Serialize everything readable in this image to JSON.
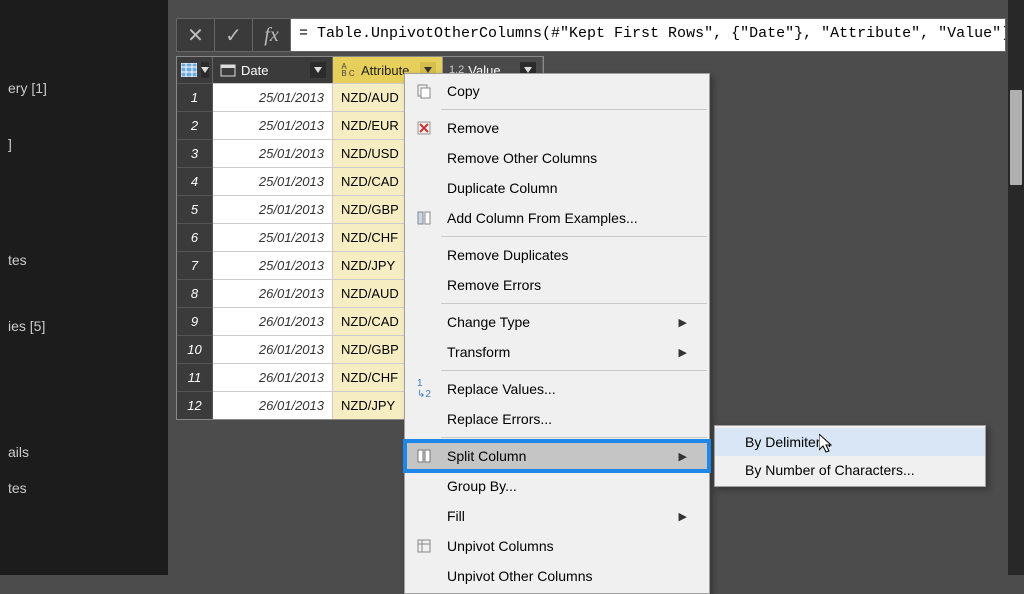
{
  "left_panel": {
    "items": [
      "ery [1]",
      "",
      "]",
      "",
      "tes",
      "",
      "ies [5]",
      "",
      "ails",
      "tes"
    ]
  },
  "formula": "= Table.UnpivotOtherColumns(#\"Kept First Rows\", {\"Date\"}, \"Attribute\", \"Value\")",
  "columns": {
    "date": "Date",
    "attribute": "Attribute",
    "value": "Value"
  },
  "rows": [
    {
      "n": "1",
      "date": "25/01/2013",
      "attr": "NZD/AUD"
    },
    {
      "n": "2",
      "date": "25/01/2013",
      "attr": "NZD/EUR"
    },
    {
      "n": "3",
      "date": "25/01/2013",
      "attr": "NZD/USD"
    },
    {
      "n": "4",
      "date": "25/01/2013",
      "attr": "NZD/CAD"
    },
    {
      "n": "5",
      "date": "25/01/2013",
      "attr": "NZD/GBP"
    },
    {
      "n": "6",
      "date": "25/01/2013",
      "attr": "NZD/CHF"
    },
    {
      "n": "7",
      "date": "25/01/2013",
      "attr": "NZD/JPY"
    },
    {
      "n": "8",
      "date": "26/01/2013",
      "attr": "NZD/AUD"
    },
    {
      "n": "9",
      "date": "26/01/2013",
      "attr": "NZD/CAD"
    },
    {
      "n": "10",
      "date": "26/01/2013",
      "attr": "NZD/GBP"
    },
    {
      "n": "11",
      "date": "26/01/2013",
      "attr": "NZD/CHF"
    },
    {
      "n": "12",
      "date": "26/01/2013",
      "attr": "NZD/JPY"
    }
  ],
  "ctx": {
    "copy": "Copy",
    "remove": "Remove",
    "remove_other": "Remove Other Columns",
    "duplicate": "Duplicate Column",
    "add_from_examples": "Add Column From Examples...",
    "remove_dup": "Remove Duplicates",
    "remove_err": "Remove Errors",
    "change_type": "Change Type",
    "transform": "Transform",
    "replace_values": "Replace Values...",
    "replace_errors": "Replace Errors...",
    "split_column": "Split Column",
    "group_by": "Group By...",
    "fill": "Fill",
    "unpivot": "Unpivot Columns",
    "unpivot_other": "Unpivot Other Columns"
  },
  "submenu": {
    "by_delim": "By Delimiter...",
    "by_chars": "By Number of Characters..."
  },
  "type_prefix": {
    "abc": "A B C",
    "num": "1.2"
  }
}
